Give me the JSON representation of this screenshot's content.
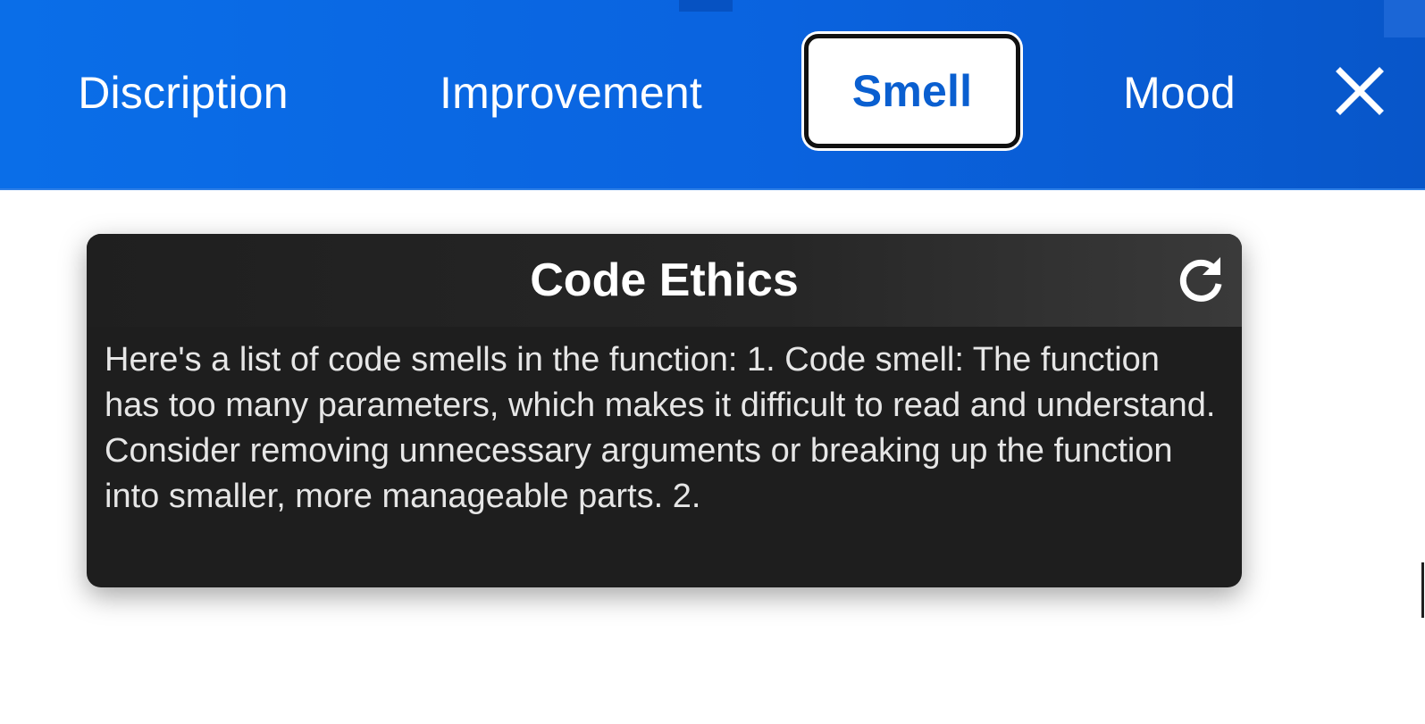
{
  "tabs": [
    {
      "label": "Discription",
      "active": false
    },
    {
      "label": "Improvement",
      "active": false
    },
    {
      "label": "Smell",
      "active": true
    },
    {
      "label": "Mood",
      "active": false
    }
  ],
  "close_icon": "close-icon",
  "card": {
    "title": "Code Ethics",
    "refresh_icon": "refresh-icon",
    "body": "Here's a list of code smells in the function: 1. Code smell: The function has too many parameters, which makes it difficult to read and understand. Consider removing unnecessary arguments or breaking up the function into smaller, more manageable parts. 2."
  },
  "colors": {
    "header_blue": "#0a6ee8",
    "active_tab_text": "#0a5fd0",
    "card_background": "#1e1e1e"
  }
}
